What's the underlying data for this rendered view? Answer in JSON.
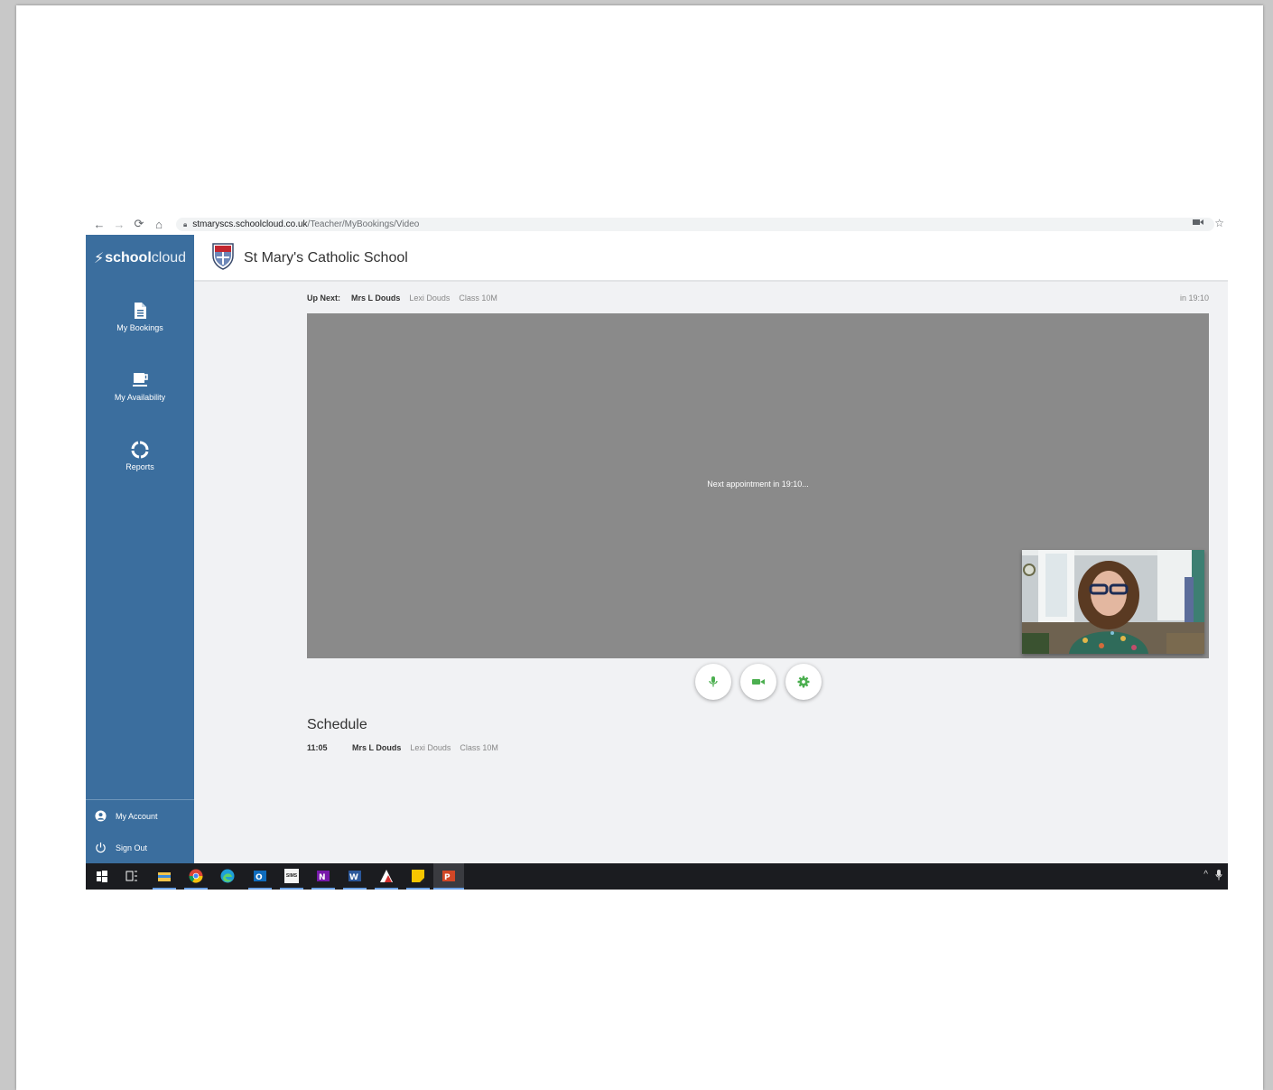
{
  "browser": {
    "url_host": "stmaryscs.schoolcloud.co.uk",
    "url_path": "/Teacher/MyBookings/Video",
    "icons": [
      "back-arrow-icon",
      "forward-arrow-icon",
      "reload-icon",
      "home-icon",
      "lock-icon",
      "camera-indicator-icon",
      "bookmark-star-icon"
    ]
  },
  "header": {
    "brand_prefix": "school",
    "brand_suffix": "cloud",
    "school_name": "St Mary's Catholic School"
  },
  "sidebar": {
    "items": [
      {
        "label": "My Bookings",
        "icon": "document-icon"
      },
      {
        "label": "My Availability",
        "icon": "coffee-cup-icon"
      },
      {
        "label": "Reports",
        "icon": "circle-arrows-icon"
      }
    ],
    "footer": [
      {
        "label": "My Account",
        "icon": "user-circle-icon"
      },
      {
        "label": "Sign Out",
        "icon": "power-icon"
      }
    ]
  },
  "upnext": {
    "label": "Up Next:",
    "teacher": "Mrs L Douds",
    "student": "Lexi Douds",
    "class": "Class 10M",
    "eta": "in 19:10"
  },
  "video": {
    "message": "Next appointment in 19:10..."
  },
  "controls": [
    {
      "name": "microphone",
      "icon": "microphone-icon"
    },
    {
      "name": "camera",
      "icon": "video-camera-icon"
    },
    {
      "name": "settings",
      "icon": "gear-icon"
    }
  ],
  "schedule": {
    "title": "Schedule",
    "rows": [
      {
        "time": "11:05",
        "teacher": "Mrs L Douds",
        "student": "Lexi Douds",
        "class": "Class 10M"
      }
    ]
  },
  "taskbar": {
    "icons": [
      "windows-start-icon",
      "task-view-icon",
      "file-explorer-icon",
      "chrome-icon",
      "edge-icon",
      "outlook-icon",
      "sims-icon",
      "onenote-icon",
      "word-icon",
      "autodesk-icon",
      "sticky-notes-icon",
      "powerpoint-icon"
    ],
    "sims_label": "SIMS",
    "tray": [
      "chevron-up-icon",
      "microphone-tray-icon"
    ]
  },
  "colors": {
    "sidebar": "#3b6e9e",
    "video_bg": "#8a8a8a",
    "accent_green": "#4caf50",
    "taskbar": "#1b1c20"
  }
}
